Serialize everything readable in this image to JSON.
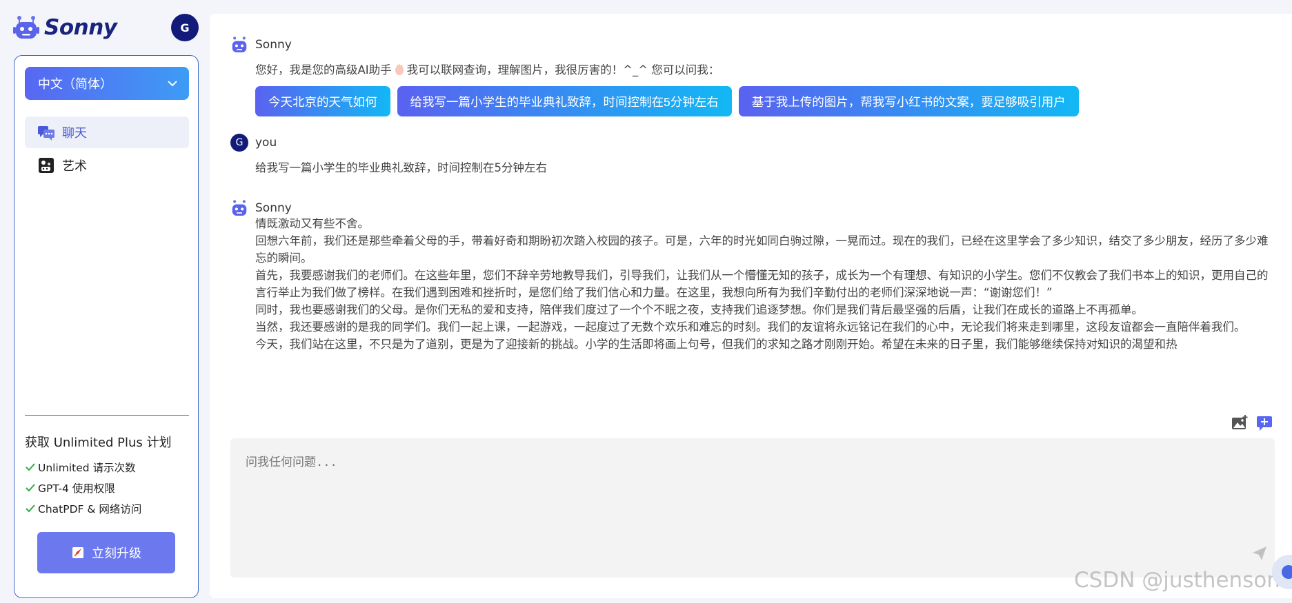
{
  "brand": {
    "name": "Sonny"
  },
  "user": {
    "initial": "G"
  },
  "sidebar": {
    "language": "中文（简体）",
    "nav": [
      {
        "label": "聊天",
        "icon": "chat-icon",
        "active": true
      },
      {
        "label": "艺术",
        "icon": "art-palette-icon",
        "active": false
      }
    ],
    "plan": {
      "title": "获取 Unlimited Plus 计划",
      "features": [
        "Unlimited 请示次数",
        "GPT-4 使用权限",
        "ChatPDF & 网络访问"
      ],
      "upgrade_label": "立刻升级"
    }
  },
  "messages": [
    {
      "sender": "Sonny",
      "text_before": "您好，我是您的高级AI助手",
      "text_after": "我可以联网查询，理解图片，我很厉害的！^_^ 您可以问我：",
      "suggestions": [
        "今天北京的天气如何",
        "给我写一篇小学生的毕业典礼致辞，时间控制在5分钟左右",
        "基于我上传的图片，帮我写小红书的文案，要足够吸引用户"
      ]
    },
    {
      "sender": "you",
      "avatar_initial": "G",
      "text": "给我写一篇小学生的毕业典礼致辞，时间控制在5分钟左右"
    },
    {
      "sender": "Sonny",
      "paragraphs": [
        "情既激动又有些不舍。",
        "回想六年前，我们还是那些牵着父母的手，带着好奇和期盼初次踏入校园的孩子。可是，六年的时光如同白驹过隙，一晃而过。现在的我们，已经在这里学会了多少知识，结交了多少朋友，经历了多少难忘的瞬间。",
        "首先，我要感谢我们的老师们。在这些年里，您们不辞辛劳地教导我们，引导我们，让我们从一个懵懂无知的孩子，成长为一个有理想、有知识的小学生。您们不仅教会了我们书本上的知识，更用自己的言行举止为我们做了榜样。在我们遇到困难和挫折时，是您们给了我们信心和力量。在这里，我想向所有为我们辛勤付出的老师们深深地说一声：“谢谢您们！”",
        "同时，我也要感谢我们的父母。是你们无私的爱和支持，陪伴我们度过了一个个不眠之夜，支持我们追逐梦想。你们是我们背后最坚强的后盾，让我们在成长的道路上不再孤单。",
        "当然，我还要感谢的是我的同学们。我们一起上课，一起游戏，一起度过了无数个欢乐和难忘的时刻。我们的友谊将永远铭记在我们的心中，无论我们将来走到哪里，这段友谊都会一直陪伴着我们。",
        "今天，我们站在这里，不只是为了道别，更是为了迎接新的挑战。小学的生活即将画上句号，但我们的求知之路才刚刚开始。希望在未来的日子里，我们能够继续保持对知识的渴望和热"
      ]
    }
  ],
  "composer": {
    "placeholder": "问我任何问题..."
  },
  "watermark": "CSDN @justhenson",
  "colors": {
    "accent": "#5867f2",
    "brand_dark": "#1a237e",
    "gradient_end": "#12b8f4"
  }
}
